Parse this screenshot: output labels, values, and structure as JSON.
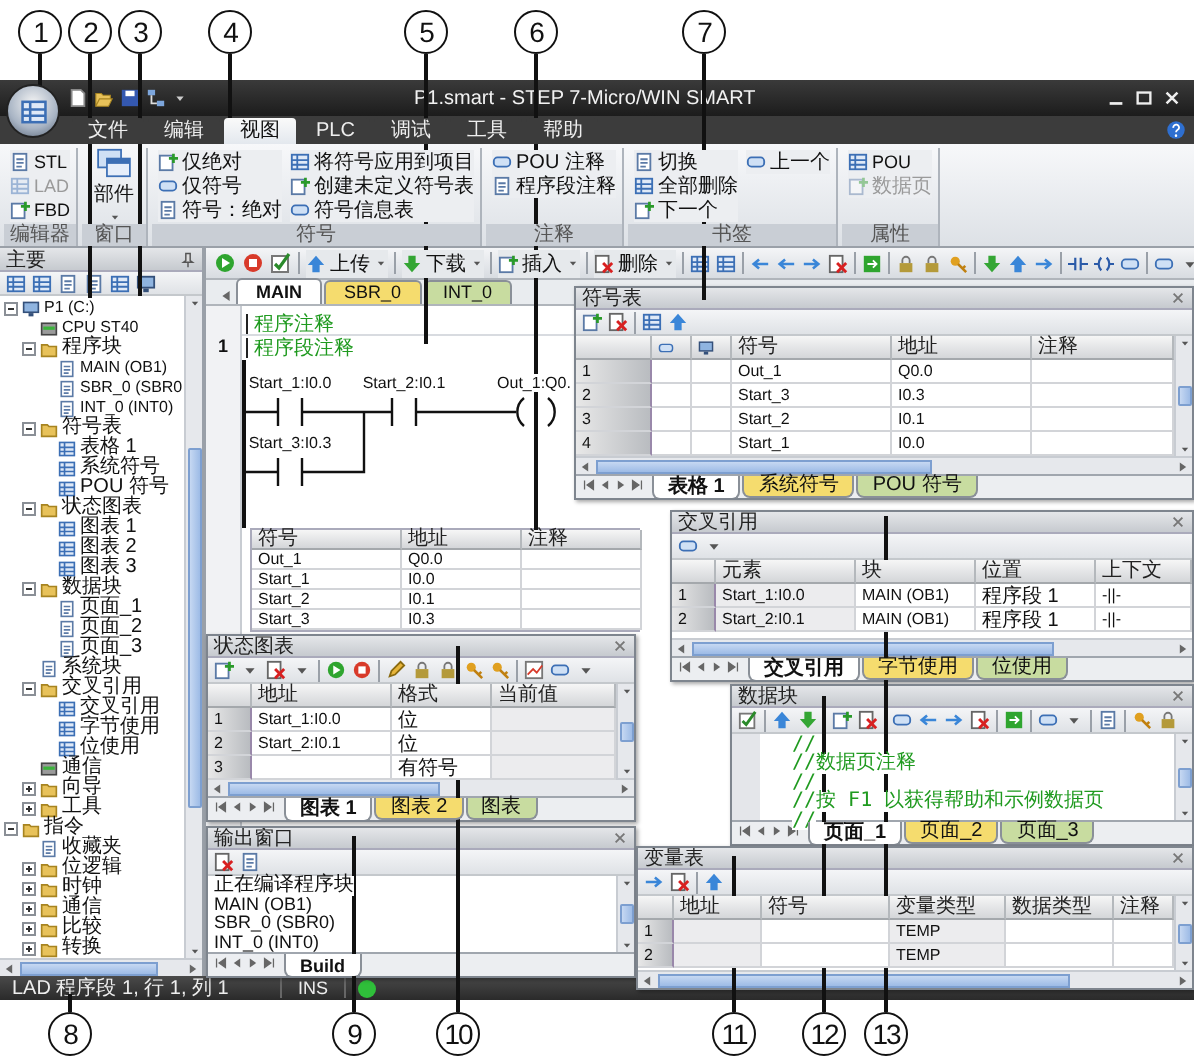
{
  "callouts": [
    {
      "label": "1"
    },
    {
      "label": "2"
    },
    {
      "label": "3"
    },
    {
      "label": "4"
    },
    {
      "label": "5"
    },
    {
      "label": "6"
    },
    {
      "label": "7"
    },
    {
      "label": "8"
    },
    {
      "label": "9"
    },
    {
      "label": "10"
    },
    {
      "label": "11"
    },
    {
      "label": "12"
    },
    {
      "label": "13"
    }
  ],
  "window": {
    "title": "P1.smart - STEP 7-Micro/WIN SMART"
  },
  "menu_tabs": [
    {
      "label": "文件",
      "selected": false
    },
    {
      "label": "编辑",
      "selected": false
    },
    {
      "label": "视图",
      "selected": true
    },
    {
      "label": "PLC",
      "selected": false
    },
    {
      "label": "调试",
      "selected": false
    },
    {
      "label": "工具",
      "selected": false
    },
    {
      "label": "帮助",
      "selected": false
    }
  ],
  "ribbon": {
    "groups": [
      {
        "label": "编辑器",
        "items": [
          {
            "label": "STL",
            "kind": "small",
            "disabled": false
          },
          {
            "label": "LAD",
            "kind": "small",
            "disabled": true
          },
          {
            "label": "FBD",
            "kind": "small",
            "disabled": false
          }
        ]
      },
      {
        "label": "窗口",
        "items": [
          {
            "label": "部件",
            "kind": "large",
            "disabled": false
          }
        ]
      },
      {
        "label": "符号",
        "items": [
          {
            "label": "仅绝对",
            "kind": "small",
            "disabled": false
          },
          {
            "label": "仅符号",
            "kind": "small",
            "disabled": false
          },
          {
            "label": "符号：绝对",
            "kind": "small",
            "disabled": false
          },
          {
            "label": "将符号应用到项目",
            "kind": "small",
            "disabled": false
          },
          {
            "label": "创建未定义符号表",
            "kind": "small",
            "disabled": false
          },
          {
            "label": "符号信息表",
            "kind": "small",
            "disabled": false
          }
        ]
      },
      {
        "label": "注释",
        "items": [
          {
            "label": "POU 注释",
            "kind": "small",
            "disabled": false
          },
          {
            "label": "程序段注释",
            "kind": "small",
            "disabled": false
          }
        ]
      },
      {
        "label": "书签",
        "items": [
          {
            "label": "切换",
            "kind": "small",
            "disabled": false
          },
          {
            "label": "全部删除",
            "kind": "small",
            "disabled": false
          },
          {
            "label": "下一个",
            "kind": "small",
            "disabled": false
          },
          {
            "label": "上一个",
            "kind": "small",
            "disabled": false
          }
        ]
      },
      {
        "label": "属性",
        "items": [
          {
            "label": "POU",
            "kind": "small",
            "disabled": false
          },
          {
            "label": "数据页",
            "kind": "small",
            "disabled": true
          }
        ]
      }
    ]
  },
  "project_tree": {
    "title": "主要",
    "items": [
      {
        "label": "P1 (C:)",
        "kind": "project",
        "expanded": true,
        "children": [
          {
            "label": "CPU ST40",
            "kind": "device"
          },
          {
            "label": "程序块",
            "kind": "folder",
            "expanded": true,
            "children": [
              {
                "label": "MAIN (OB1)",
                "kind": "page"
              },
              {
                "label": "SBR_0 (SBR0",
                "kind": "page"
              },
              {
                "label": "INT_0 (INT0)",
                "kind": "page"
              }
            ]
          },
          {
            "label": "符号表",
            "kind": "folder",
            "expanded": true,
            "children": [
              {
                "label": "表格 1",
                "kind": "table"
              },
              {
                "label": "系统符号",
                "kind": "table"
              },
              {
                "label": "POU 符号",
                "kind": "table"
              }
            ]
          },
          {
            "label": "状态图表",
            "kind": "folder",
            "expanded": true,
            "children": [
              {
                "label": "图表 1",
                "kind": "table"
              },
              {
                "label": "图表 2",
                "kind": "table"
              },
              {
                "label": "图表 3",
                "kind": "table"
              }
            ]
          },
          {
            "label": "数据块",
            "kind": "folder",
            "expanded": true,
            "children": [
              {
                "label": "页面_1",
                "kind": "page"
              },
              {
                "label": "页面_2",
                "kind": "page"
              },
              {
                "label": "页面_3",
                "kind": "page"
              }
            ]
          },
          {
            "label": "系统块",
            "kind": "page"
          },
          {
            "label": "交叉引用",
            "kind": "folder",
            "expanded": true,
            "children": [
              {
                "label": "交叉引用",
                "kind": "table"
              },
              {
                "label": "字节使用",
                "kind": "table"
              },
              {
                "label": "位使用",
                "kind": "table"
              }
            ]
          },
          {
            "label": "通信",
            "kind": "device"
          },
          {
            "label": "向导",
            "kind": "folder",
            "expanded": false
          },
          {
            "label": "工具",
            "kind": "folder",
            "expanded": false
          }
        ]
      },
      {
        "label": "指令",
        "kind": "folder",
        "expanded": true,
        "children": [
          {
            "label": "收藏夹",
            "kind": "page"
          },
          {
            "label": "位逻辑",
            "kind": "folder",
            "expanded": false
          },
          {
            "label": "时钟",
            "kind": "folder",
            "expanded": false
          },
          {
            "label": "通信",
            "kind": "folder",
            "expanded": false
          },
          {
            "label": "比较",
            "kind": "folder",
            "expanded": false
          },
          {
            "label": "转换",
            "kind": "folder",
            "expanded": false
          }
        ]
      }
    ]
  },
  "editor": {
    "toolbar": [
      {
        "label": "上传"
      },
      {
        "label": "下载"
      },
      {
        "label": "插入"
      },
      {
        "label": "删除"
      }
    ],
    "tabs": [
      {
        "label": "MAIN",
        "selected": true,
        "color": "#ffffff"
      },
      {
        "label": "SBR_0",
        "selected": false,
        "color": "#f5dc6e"
      },
      {
        "label": "INT_0",
        "selected": false,
        "color": "#c8dca0"
      }
    ],
    "program_comment": "程序注释",
    "network": {
      "number": "1",
      "comment": "程序段注释"
    },
    "ladder": [
      {
        "kind": "contact",
        "label": "Start_1:I0.0"
      },
      {
        "kind": "contact",
        "label": "Start_2:I0.1"
      },
      {
        "kind": "coil",
        "label": "Out_1:Q0."
      },
      {
        "kind": "contact",
        "label": "Start_3:I0.3"
      }
    ],
    "symbol_info": {
      "columns": [
        "符号",
        "地址",
        "注释"
      ],
      "rows": [
        {
          "symbol": "Out_1",
          "address": "Q0.0"
        },
        {
          "symbol": "Start_1",
          "address": "I0.0"
        },
        {
          "symbol": "Start_2",
          "address": "I0.1"
        },
        {
          "symbol": "Start_3",
          "address": "I0.3"
        }
      ]
    }
  },
  "symbol_table": {
    "title": "符号表",
    "columns": [
      "符号",
      "地址",
      "注释"
    ],
    "rows": [
      {
        "number": "1",
        "symbol": "Out_1",
        "address": "Q0.0"
      },
      {
        "number": "2",
        "symbol": "Start_3",
        "address": "I0.3"
      },
      {
        "number": "3",
        "symbol": "Start_2",
        "address": "I0.1"
      },
      {
        "number": "4",
        "symbol": "Start_1",
        "address": "I0.0"
      }
    ],
    "tabs": [
      {
        "label": "表格 1",
        "selected": true,
        "color": "#ffffff"
      },
      {
        "label": "系统符号",
        "selected": false,
        "color": "#f5dc6e"
      },
      {
        "label": "POU 符号",
        "selected": false,
        "color": "#c8dca0"
      }
    ]
  },
  "cross_reference": {
    "title": "交叉引用",
    "columns": [
      "元素",
      "块",
      "位置",
      "上下文"
    ],
    "rows": [
      {
        "number": "1",
        "element": "Start_1:I0.0",
        "block": "MAIN (OB1)",
        "location": "程序段 1",
        "context": "-||-"
      },
      {
        "number": "2",
        "element": "Start_2:I0.1",
        "block": "MAIN (OB1)",
        "location": "程序段 1",
        "context": "-||-"
      }
    ],
    "tabs": [
      {
        "label": "交叉引用",
        "selected": true,
        "color": "#ffffff"
      },
      {
        "label": "字节使用",
        "selected": false,
        "color": "#f5dc6e"
      },
      {
        "label": "位使用",
        "selected": false,
        "color": "#c8dca0"
      }
    ]
  },
  "status_chart": {
    "title": "状态图表",
    "columns": [
      "地址",
      "格式",
      "当前值"
    ],
    "rows": [
      {
        "number": "1",
        "address": "Start_1:I0.0",
        "format": "位"
      },
      {
        "number": "2",
        "address": "Start_2:I0.1",
        "format": "位"
      },
      {
        "number": "3",
        "format": "有符号"
      }
    ],
    "tabs": [
      {
        "label": "图表 1",
        "selected": true,
        "color": "#ffffff"
      },
      {
        "label": "图表 2",
        "selected": false,
        "color": "#f5dc6e"
      },
      {
        "label": "图表",
        "selected": false,
        "color": "#c8dca0"
      }
    ]
  },
  "data_block": {
    "title": "数据块",
    "lines": [
      "//",
      "//数据页注释",
      "//",
      "//按 F1 以获得帮助和示例数据页",
      "//"
    ],
    "tabs": [
      {
        "label": "页面_1",
        "selected": true,
        "color": "#ffffff"
      },
      {
        "label": "页面_2",
        "selected": false,
        "color": "#f5dc6e"
      },
      {
        "label": "页面_3",
        "selected": false,
        "color": "#c8dca0"
      }
    ]
  },
  "output_window": {
    "title": "输出窗口",
    "lines": [
      "正在编译程序块",
      "MAIN (OB1)",
      "SBR_0 (SBR0)",
      "INT_0 (INT0)"
    ],
    "tabs": [
      {
        "label": "Build",
        "selected": true,
        "color": "#ffffff"
      }
    ]
  },
  "variable_table": {
    "title": "变量表",
    "columns": [
      "地址",
      "符号",
      "变量类型",
      "数据类型",
      "注释"
    ],
    "rows": [
      {
        "number": "1",
        "var_type": "TEMP"
      },
      {
        "number": "2",
        "var_type": "TEMP"
      }
    ]
  },
  "status_bar": {
    "position": "LAD 程序段 1, 行 1, 列 1",
    "mode": "INS"
  }
}
